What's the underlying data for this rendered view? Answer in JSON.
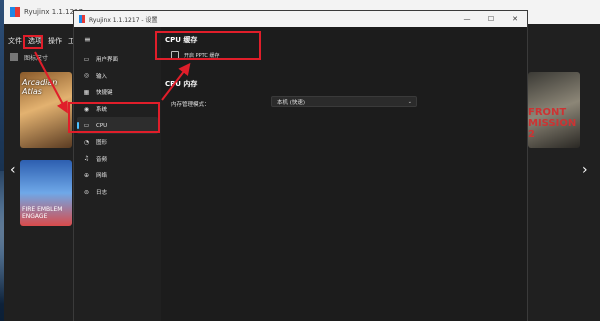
{
  "main_window": {
    "title": "Ryujinx 1.1.1217",
    "menu": [
      "文件",
      "选项",
      "操作",
      "工具"
    ],
    "toolbar_label": "图标尺寸",
    "covers": [
      "Arcadian Atlas",
      "FIRE EMBLEM ENGAGE",
      "FRONT MISSION 2"
    ]
  },
  "dialog": {
    "title": "Ryujinx 1.1.1217 - 设置",
    "controls": {
      "minimize": "—",
      "maximize": "☐",
      "close": "✕"
    },
    "nav": [
      {
        "label": "用户界面",
        "icon": "user-interface-icon",
        "glyph": "▭"
      },
      {
        "label": "输入",
        "icon": "gamepad-icon",
        "glyph": "◎"
      },
      {
        "label": "快捷键",
        "icon": "keyboard-icon",
        "glyph": "▦"
      },
      {
        "label": "系统",
        "icon": "system-icon",
        "glyph": "◉"
      },
      {
        "label": "CPU",
        "icon": "cpu-icon",
        "glyph": "▭",
        "active": true
      },
      {
        "label": "图形",
        "icon": "graphics-icon",
        "glyph": "◔"
      },
      {
        "label": "音频",
        "icon": "audio-icon",
        "glyph": "♫"
      },
      {
        "label": "网络",
        "icon": "network-icon",
        "glyph": "⊕"
      },
      {
        "label": "日志",
        "icon": "log-icon",
        "glyph": "⊜"
      }
    ],
    "content": {
      "cpu_cache_title": "CPU 缓存",
      "pptc_checkbox_label": "开启 PPTC 缓存",
      "pptc_checked": false,
      "cpu_memory_title": "CPU 内存",
      "memory_mode_label": "内存管理模式：",
      "memory_mode_value": "本机 (快速)"
    }
  },
  "annotation_color": "#e01e2a"
}
